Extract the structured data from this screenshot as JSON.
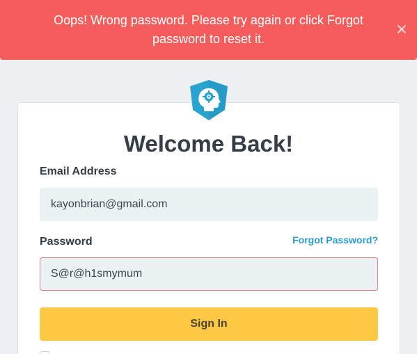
{
  "alert": {
    "message": "Oops! Wrong password. Please try again or click Forgot password to reset it.",
    "close_icon": "close-icon",
    "background_color": "#f55d5d"
  },
  "logo": {
    "icon": "brain-head-shield-logo",
    "color": "#2aa3cf"
  },
  "login": {
    "title": "Welcome Back!",
    "email_label": "Email Address",
    "email_value": "kayonbrian@gmail.com",
    "password_label": "Password",
    "forgot_link": "Forgot Password?",
    "password_value": "S@r@h1smymum",
    "sign_in_label": "Sign In",
    "sign_in_color": "#fdc844"
  }
}
